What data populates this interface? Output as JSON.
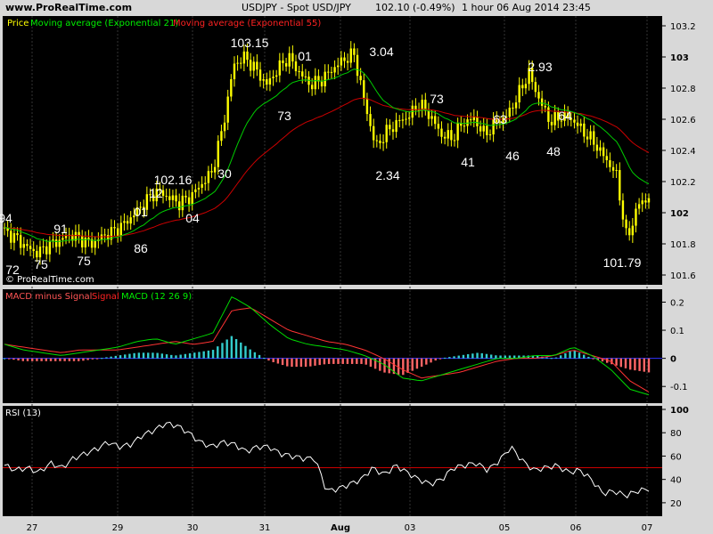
{
  "header": {
    "site": "www.ProRealTime.com",
    "title": "USDJPY - Spot USD/JPY",
    "price_change": "102.10 (-0.49%)",
    "timeframe_date": "1 hour  06 Aug 2014 23:45"
  },
  "watermark": "© ProRealTime.com",
  "colors": {
    "price": "#ffff00",
    "ema21": "#00cc00",
    "ema55": "#cc0000",
    "macd_signal": "#ff3333",
    "macd_line": "#00dd00",
    "hist_pos": "#33cccc",
    "hist_neg": "#ff6666",
    "rsi": "#ffffff",
    "rsi_50": "#cc0000",
    "zero_line": "#3333ff"
  },
  "chart_data": [
    {
      "type": "candlestick",
      "title": "",
      "legend": [
        "Price",
        "Moving average (Exponential 21)",
        "Moving average (Exponential 55)"
      ],
      "ylim": [
        101.56,
        103.24
      ],
      "y_ticks": [
        "103.2",
        "103",
        "102.8",
        "102.6",
        "102.4",
        "102.2",
        "102",
        "101.8",
        "101.6"
      ],
      "x_ticks": [
        "27",
        "29",
        "30",
        "31",
        "Aug",
        "03",
        "05",
        "06",
        "07"
      ],
      "annotations": [
        "94",
        "72",
        "75",
        "91",
        "75",
        "86",
        "01",
        "12",
        "102.16",
        "04",
        "30",
        "103.15",
        "73",
        "01",
        "3.04",
        "2.34",
        "73",
        "41",
        "63",
        "46",
        "2.93",
        "48",
        "64",
        "101.79"
      ],
      "price_path": [
        101.88,
        101.84,
        101.78,
        101.74,
        101.79,
        101.82,
        101.86,
        101.83,
        101.8,
        101.85,
        101.88,
        101.93,
        102.0,
        102.08,
        102.14,
        102.1,
        102.06,
        102.1,
        102.18,
        102.26,
        102.55,
        102.95,
        103.0,
        102.92,
        102.82,
        102.92,
        103.0,
        102.9,
        102.82,
        102.85,
        102.92,
        102.98,
        103.02,
        102.7,
        102.42,
        102.52,
        102.58,
        102.62,
        102.7,
        102.62,
        102.5,
        102.48,
        102.58,
        102.6,
        102.5,
        102.58,
        102.62,
        102.75,
        102.9,
        102.72,
        102.58,
        102.62,
        102.6,
        102.52,
        102.45,
        102.35,
        102.25,
        101.82,
        102.05,
        102.1
      ]
    },
    {
      "type": "macd",
      "title": "",
      "legend": [
        "MACD minus Signal",
        "Signal",
        "MACD (12 26 9)"
      ],
      "ylim": [
        -0.15,
        0.23
      ],
      "y_ticks": [
        "0.2",
        "0.1",
        "0",
        "-0.1"
      ],
      "macd_path": [
        0.05,
        0.03,
        0.02,
        0.01,
        0.02,
        0.03,
        0.04,
        0.06,
        0.07,
        0.05,
        0.07,
        0.09,
        0.22,
        0.18,
        0.12,
        0.07,
        0.05,
        0.04,
        0.03,
        0.01,
        -0.02,
        -0.07,
        -0.08,
        -0.06,
        -0.04,
        -0.02,
        0.0,
        0.0,
        0.01,
        0.01,
        0.04,
        0.01,
        -0.04,
        -0.11,
        -0.13
      ],
      "signal_path": [
        0.05,
        0.04,
        0.03,
        0.02,
        0.03,
        0.03,
        0.03,
        0.04,
        0.05,
        0.06,
        0.05,
        0.06,
        0.17,
        0.18,
        0.14,
        0.1,
        0.08,
        0.06,
        0.05,
        0.03,
        0.0,
        -0.04,
        -0.07,
        -0.06,
        -0.05,
        -0.03,
        -0.01,
        0.0,
        0.0,
        0.01,
        0.03,
        0.01,
        -0.01,
        -0.08,
        -0.12
      ],
      "histogram": [
        0.0,
        -0.01,
        -0.01,
        -0.01,
        -0.01,
        0.0,
        0.01,
        0.02,
        0.02,
        0.01,
        0.02,
        0.03,
        0.08,
        0.03,
        -0.01,
        -0.03,
        -0.03,
        -0.02,
        -0.02,
        -0.02,
        -0.05,
        -0.06,
        -0.03,
        0.0,
        0.01,
        0.02,
        0.01,
        0.01,
        0.01,
        0.0,
        0.03,
        0.0,
        -0.02,
        -0.04,
        -0.05
      ]
    },
    {
      "type": "line",
      "title": "",
      "legend": [
        "RSI (13)"
      ],
      "ylim": [
        10,
        100
      ],
      "y_ticks": [
        "100",
        "80",
        "60",
        "40",
        "20"
      ],
      "reference_line": 50,
      "rsi_path": [
        52,
        48,
        50,
        46,
        54,
        50,
        58,
        62,
        66,
        72,
        68,
        70,
        78,
        82,
        88,
        86,
        80,
        72,
        68,
        72,
        70,
        64,
        68,
        68,
        62,
        60,
        58,
        58,
        30,
        32,
        36,
        40,
        50,
        44,
        52,
        46,
        40,
        36,
        40,
        50,
        52,
        54,
        48,
        56,
        68,
        56,
        48,
        50,
        52,
        46,
        48,
        40,
        28,
        30,
        26,
        30,
        32
      ]
    }
  ]
}
